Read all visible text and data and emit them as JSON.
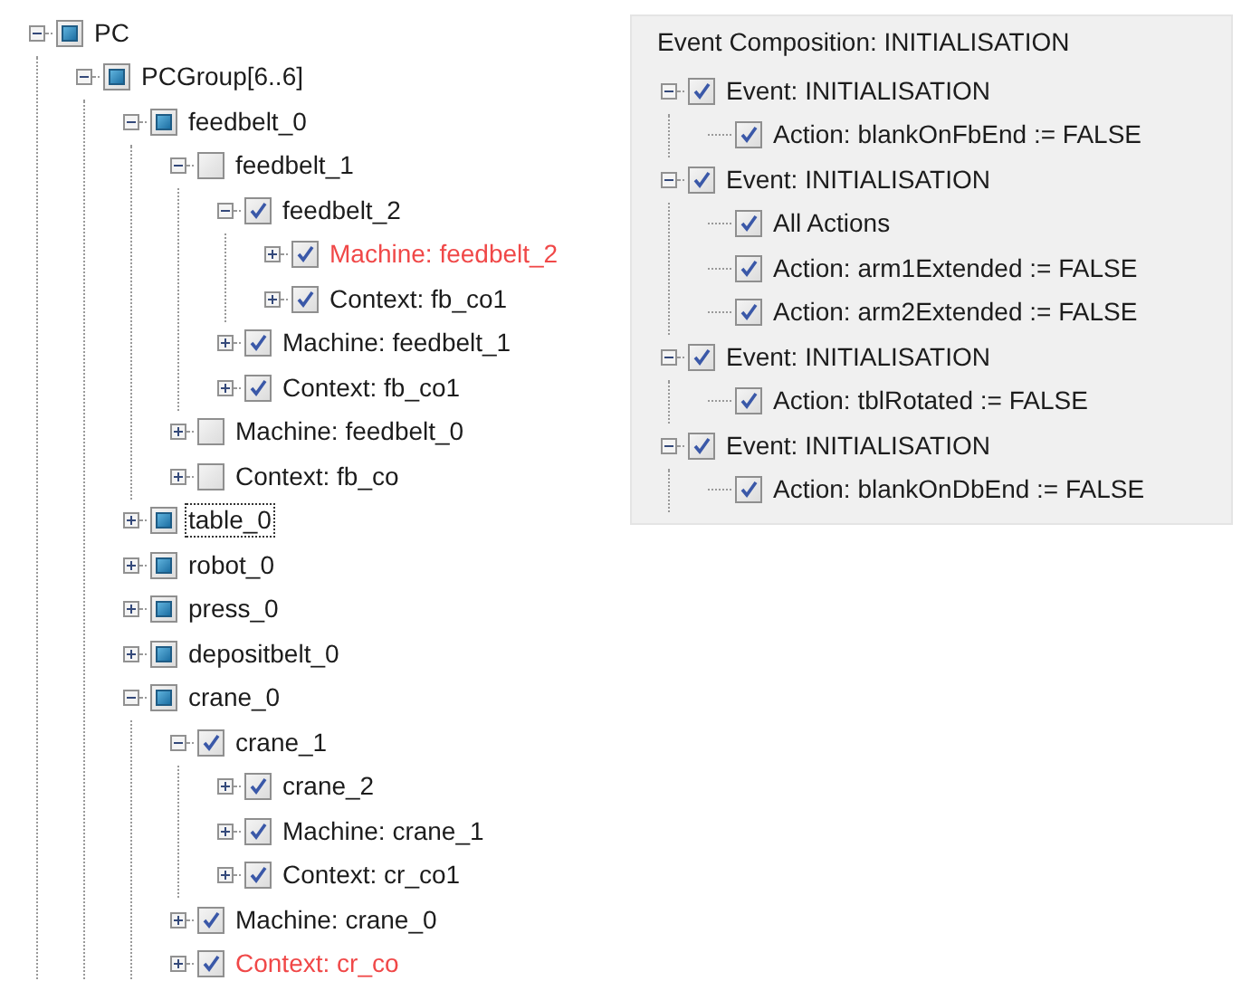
{
  "tree": [
    {
      "label": "PC",
      "mixed": true,
      "expanded": true,
      "highlighted": false,
      "focused": false,
      "children": [
        {
          "label": "PCGroup[6..6]",
          "mixed": true,
          "expanded": true,
          "highlighted": false,
          "focused": false,
          "children": [
            {
              "label": "feedbelt_0",
              "mixed": true,
              "expanded": true,
              "highlighted": false,
              "focused": false,
              "children": [
                {
                  "label": "feedbelt_1",
                  "checked": false,
                  "expanded": true,
                  "highlighted": false,
                  "focused": false,
                  "children": [
                    {
                      "label": "feedbelt_2",
                      "checked": true,
                      "expanded": true,
                      "highlighted": false,
                      "focused": false,
                      "children": [
                        {
                          "label": "Machine: feedbelt_2",
                          "checked": true,
                          "expanded": false,
                          "highlighted": true,
                          "focused": false
                        },
                        {
                          "label": "Context: fb_co1",
                          "checked": true,
                          "expanded": false,
                          "highlighted": false,
                          "focused": false
                        }
                      ]
                    },
                    {
                      "label": "Machine: feedbelt_1",
                      "checked": true,
                      "expanded": false,
                      "highlighted": false,
                      "focused": false
                    },
                    {
                      "label": "Context: fb_co1",
                      "checked": true,
                      "expanded": false,
                      "highlighted": false,
                      "focused": false
                    }
                  ]
                },
                {
                  "label": "Machine: feedbelt_0",
                  "checked": false,
                  "expanded": false,
                  "highlighted": false,
                  "focused": false
                },
                {
                  "label": "Context: fb_co",
                  "checked": false,
                  "expanded": false,
                  "highlighted": false,
                  "focused": false
                }
              ]
            },
            {
              "label": "table_0",
              "mixed": true,
              "expanded": false,
              "highlighted": false,
              "focused": true
            },
            {
              "label": "robot_0",
              "mixed": true,
              "expanded": false,
              "highlighted": false,
              "focused": false
            },
            {
              "label": "press_0",
              "mixed": true,
              "expanded": false,
              "highlighted": false,
              "focused": false
            },
            {
              "label": "depositbelt_0",
              "mixed": true,
              "expanded": false,
              "highlighted": false,
              "focused": false
            },
            {
              "label": "crane_0",
              "mixed": true,
              "expanded": true,
              "highlighted": false,
              "focused": false,
              "children": [
                {
                  "label": "crane_1",
                  "checked": true,
                  "expanded": true,
                  "highlighted": false,
                  "focused": false,
                  "children": [
                    {
                      "label": "crane_2",
                      "checked": true,
                      "expanded": false,
                      "highlighted": false,
                      "focused": false
                    },
                    {
                      "label": "Machine: crane_1",
                      "checked": true,
                      "expanded": false,
                      "highlighted": false,
                      "focused": false
                    },
                    {
                      "label": "Context: cr_co1",
                      "checked": true,
                      "expanded": false,
                      "highlighted": false,
                      "focused": false
                    }
                  ]
                },
                {
                  "label": "Machine: crane_0",
                  "checked": true,
                  "expanded": false,
                  "highlighted": false,
                  "focused": false
                },
                {
                  "label": "Context: cr_co",
                  "checked": true,
                  "expanded": false,
                  "highlighted": true,
                  "focused": false
                }
              ]
            }
          ]
        }
      ]
    }
  ],
  "event_panel": {
    "title": "Event Composition: INITIALISATION",
    "events": [
      {
        "label": "Event: INITIALISATION",
        "checked": true,
        "expanded": true,
        "children": [
          {
            "label": "Action: blankOnFbEnd := FALSE",
            "checked": true
          }
        ]
      },
      {
        "label": "Event: INITIALISATION",
        "checked": true,
        "expanded": true,
        "children": [
          {
            "label": "All Actions",
            "checked": true
          },
          {
            "label": "Action: arm1Extended := FALSE",
            "checked": true
          },
          {
            "label": "Action: arm2Extended := FALSE",
            "checked": true
          }
        ]
      },
      {
        "label": "Event: INITIALISATION",
        "checked": true,
        "expanded": true,
        "children": [
          {
            "label": "Action: tblRotated := FALSE",
            "checked": true
          }
        ]
      },
      {
        "label": "Event: INITIALISATION",
        "checked": true,
        "expanded": true,
        "children": [
          {
            "label": "Action: blankOnDbEnd := FALSE",
            "checked": true
          }
        ]
      }
    ]
  }
}
